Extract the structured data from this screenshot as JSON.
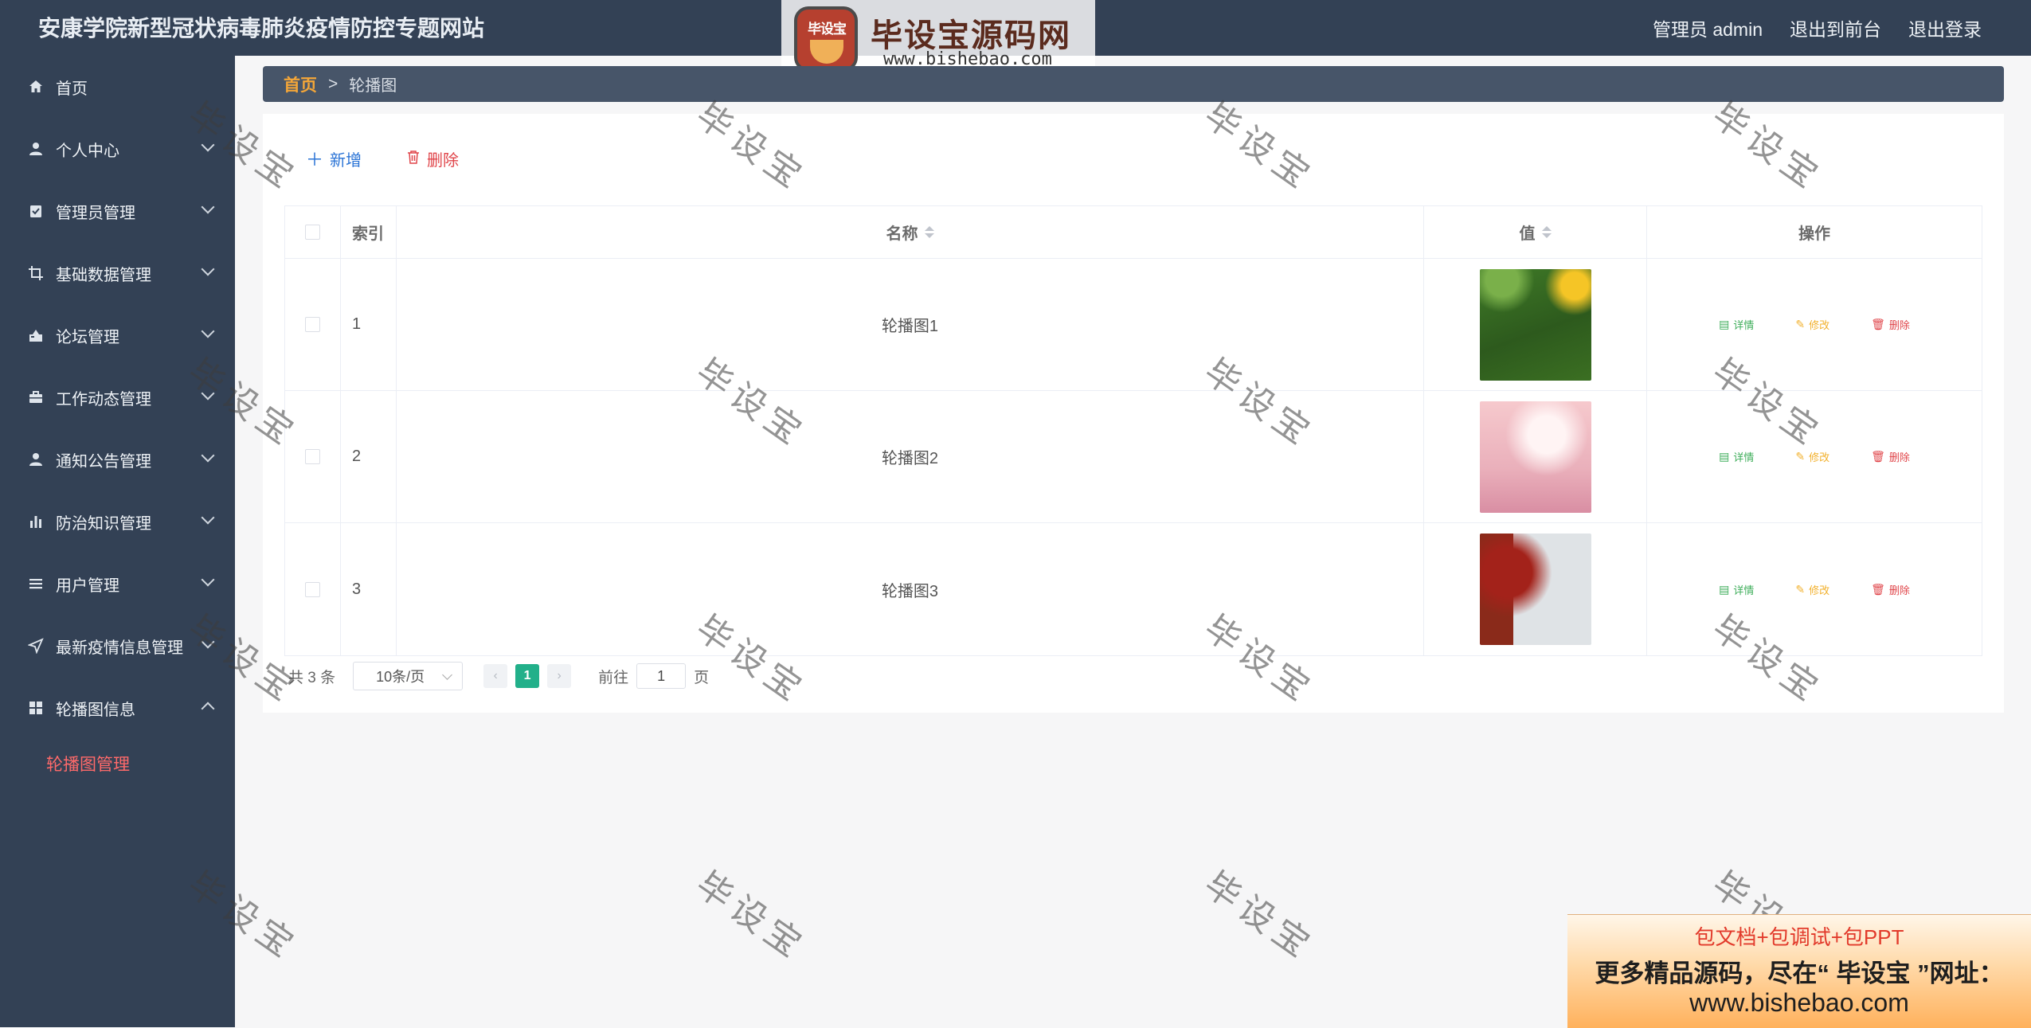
{
  "header": {
    "site_title": "安康学院新型冠状病毒肺炎疫情防控专题网站",
    "user_label": "管理员 admin",
    "to_front_label": "退出到前台",
    "logout_label": "退出登录"
  },
  "logo_watermark": {
    "badge_text": "毕设宝",
    "main_text": "毕设宝源码网",
    "url": "www.bishebao.com"
  },
  "sidebar": {
    "items": [
      {
        "label": "首页",
        "icon": "home-icon"
      },
      {
        "label": "个人中心",
        "icon": "user-icon"
      },
      {
        "label": "管理员管理",
        "icon": "clipboard-check-icon"
      },
      {
        "label": "基础数据管理",
        "icon": "crop-icon"
      },
      {
        "label": "论坛管理",
        "icon": "forum-icon"
      },
      {
        "label": "工作动态管理",
        "icon": "briefcase-icon"
      },
      {
        "label": "通知公告管理",
        "icon": "user-icon"
      },
      {
        "label": "防治知识管理",
        "icon": "bar-chart-icon"
      },
      {
        "label": "用户管理",
        "icon": "list-icon"
      },
      {
        "label": "最新疫情信息管理",
        "icon": "send-icon"
      },
      {
        "label": "轮播图信息",
        "icon": "grid-icon"
      }
    ],
    "active_submenu": "轮播图管理"
  },
  "breadcrumb": {
    "home": "首页",
    "separator": ">",
    "current": "轮播图"
  },
  "toolbar": {
    "add_label": "新增",
    "delete_label": "删除"
  },
  "table": {
    "columns": {
      "index": "索引",
      "name": "名称",
      "value": "值",
      "actions": "操作"
    },
    "rows": [
      {
        "index": "1",
        "name": "轮播图1",
        "image": "green-foliage-sunflower-thumbnail"
      },
      {
        "index": "2",
        "name": "轮播图2",
        "image": "pink-blossom-thumbnail"
      },
      {
        "index": "3",
        "name": "轮播图3",
        "image": "red-tree-snow-thumbnail"
      }
    ],
    "row_actions": {
      "detail": "详情",
      "edit": "修改",
      "delete": "删除"
    }
  },
  "pagination": {
    "total_text": "共 3 条",
    "page_size": "10条/页",
    "current_page": "1",
    "goto_label": "前往",
    "goto_value": "1",
    "page_suffix": "页"
  },
  "watermark_text": "毕设宝",
  "ad": {
    "line1": "包文档+包调试+包PPT",
    "line2": "更多精品源码，尽在“ 毕设宝 ”网址：",
    "line3": "www.bishebao.com"
  },
  "colors": {
    "header_bg": "#334155",
    "breadcrumb_bg": "#475569",
    "accent_home": "#f4a638",
    "active_submenu": "#ff6a6a",
    "page_active": "#22b08a",
    "add": "#2b74d6",
    "danger": "#e0454a",
    "detail": "#3fae5b",
    "edit": "#f2b12e"
  }
}
